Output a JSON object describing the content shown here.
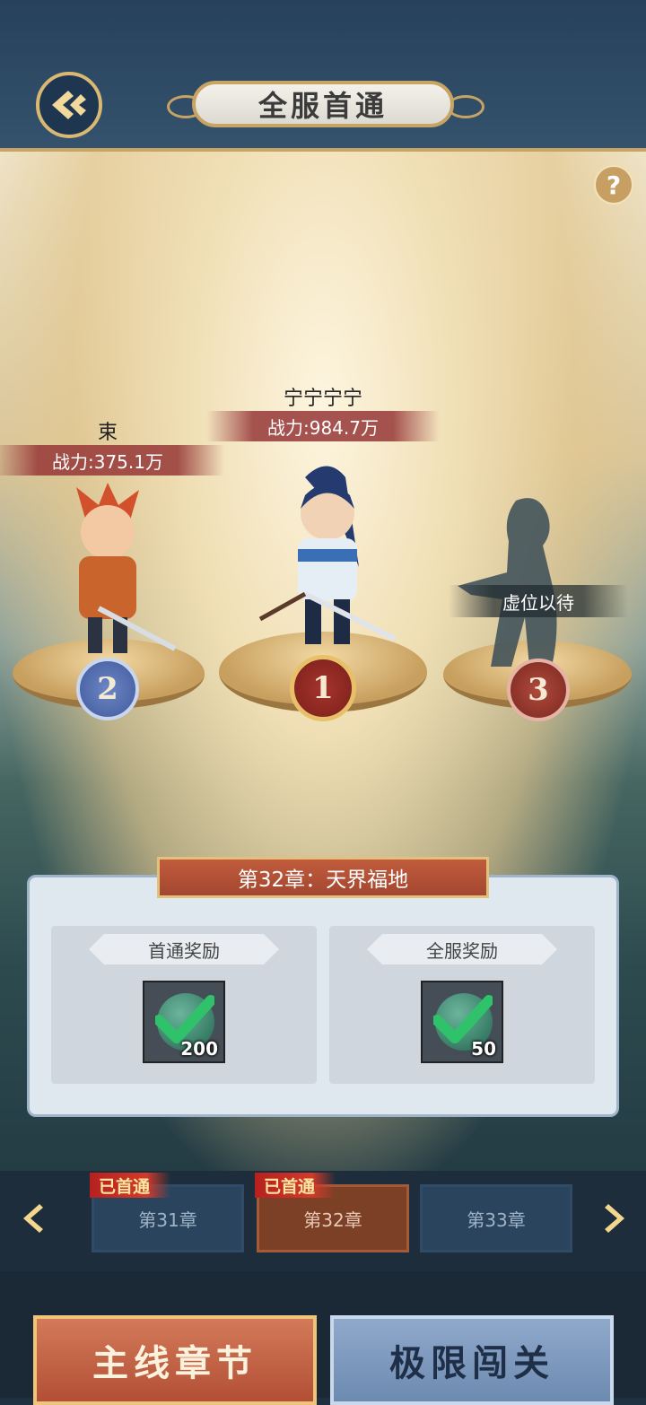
{
  "header": {
    "title": "全服首通",
    "back_icon": "back-arrow-icon"
  },
  "help": {
    "label": "?"
  },
  "podium": {
    "first": {
      "name": "宁宁宁宁",
      "power": "战力:984.7万",
      "rank": "1"
    },
    "second": {
      "name": "束",
      "power": "战力:375.1万",
      "rank": "2"
    },
    "third": {
      "placeholder": "虚位以待",
      "rank": "3"
    }
  },
  "chapter_panel": {
    "title": "第32章：天界福地",
    "rewards": [
      {
        "title": "首通奖励",
        "quantity": "200",
        "claimed": true
      },
      {
        "title": "全服奖励",
        "quantity": "50",
        "claimed": true
      }
    ]
  },
  "chapter_tabs": [
    {
      "label": "第31章",
      "tag": "已首通",
      "active": false
    },
    {
      "label": "第32章",
      "tag": "已首通",
      "active": true
    },
    {
      "label": "第33章",
      "tag": "",
      "active": false
    }
  ],
  "bottom_buttons": {
    "main": "主线章节",
    "limit": "极限闯关"
  },
  "colors": {
    "accent_gold": "#c7a364",
    "active_tab": "#7b4026",
    "tag_red": "#b6201f"
  }
}
